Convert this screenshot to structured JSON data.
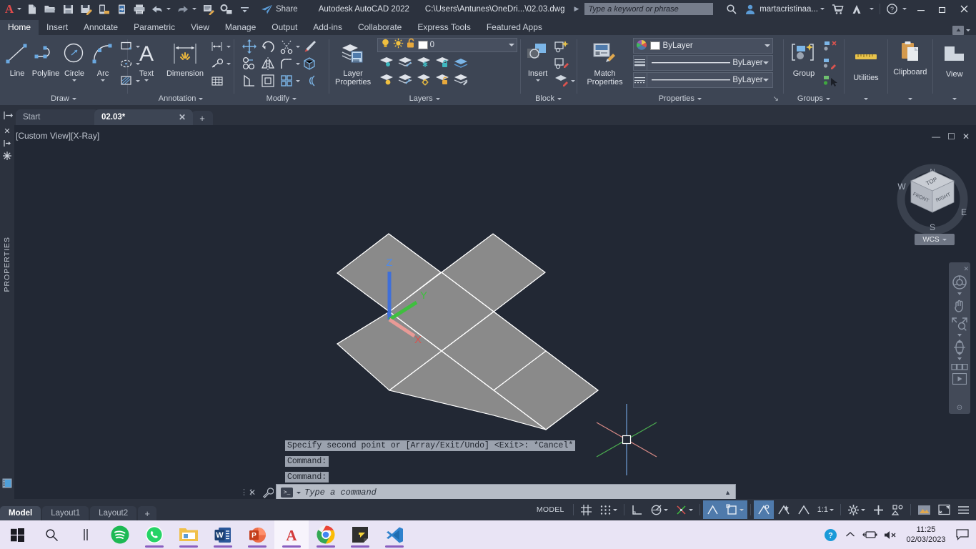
{
  "titlebar": {
    "app_title": "Autodesk AutoCAD 2022",
    "file_path": "C:\\Users\\Antunes\\OneDri...\\02.03.dwg",
    "search_placeholder": "Type a keyword or phrase",
    "share_label": "Share",
    "user_name": "martacristinaa...",
    "quick_access": [
      {
        "name": "new-icon",
        "title": "New"
      },
      {
        "name": "open-icon",
        "title": "Open"
      },
      {
        "name": "save-icon",
        "title": "Save"
      },
      {
        "name": "save-as-icon",
        "title": "Save As"
      },
      {
        "name": "save-to-web-icon",
        "title": "Save to Web & Mobile"
      },
      {
        "name": "open-from-web-icon",
        "title": "Open from Web & Mobile"
      },
      {
        "name": "plot-icon",
        "title": "Plot"
      },
      {
        "name": "undo-icon",
        "title": "Undo"
      },
      {
        "name": "redo-icon",
        "title": "Redo"
      },
      {
        "name": "batch-plot-icon",
        "title": "Batch Plot"
      },
      {
        "name": "attach-icon",
        "title": "Attach"
      }
    ],
    "window_buttons": [
      "minimize",
      "restore",
      "close"
    ]
  },
  "ribbon_tabs": [
    {
      "label": "Home",
      "active": true
    },
    {
      "label": "Insert",
      "active": false
    },
    {
      "label": "Annotate",
      "active": false
    },
    {
      "label": "Parametric",
      "active": false
    },
    {
      "label": "View",
      "active": false
    },
    {
      "label": "Manage",
      "active": false
    },
    {
      "label": "Output",
      "active": false
    },
    {
      "label": "Add-ins",
      "active": false
    },
    {
      "label": "Collaborate",
      "active": false
    },
    {
      "label": "Express Tools",
      "active": false
    },
    {
      "label": "Featured Apps",
      "active": false
    }
  ],
  "ribbon": {
    "draw": {
      "title": "Draw",
      "buttons": [
        {
          "label": "Line",
          "icon": "line-icon"
        },
        {
          "label": "Polyline",
          "icon": "polyline-icon"
        },
        {
          "label": "Circle",
          "icon": "circle-icon"
        },
        {
          "label": "Arc",
          "icon": "arc-icon"
        }
      ],
      "small": [
        "rectangle-icon",
        "ellipse-icon",
        "hatch-icon"
      ]
    },
    "annotation": {
      "title": "Annotation",
      "buttons": [
        {
          "label": "Text",
          "icon": "text-icon"
        },
        {
          "label": "Dimension",
          "icon": "dimension-icon"
        }
      ],
      "small": [
        "linear-dimension-icon",
        "leader-icon",
        "table-icon"
      ]
    },
    "modify": {
      "title": "Modify",
      "small": [
        "move-icon",
        "rotate-icon",
        "trim-icon",
        "erase-icon",
        "copy-icon",
        "mirror-icon",
        "fillet-icon",
        "array-3d-icon",
        "stretch-icon",
        "scale-icon",
        "array-icon",
        "offset-icon"
      ]
    },
    "layers": {
      "title": "Layers",
      "button": {
        "label": "Layer\nProperties",
        "icon": "layer-properties-icon"
      },
      "current_layer": "0",
      "layer_toggles": [
        "lightbulb-icon",
        "sun-icon",
        "unlock-icon"
      ],
      "small": [
        "layer-isolate-icon",
        "layer-unisolate-icon",
        "layer-freeze-icon",
        "layer-lock-icon",
        "layer-make-current-icon",
        "layer-off-icon",
        "layer-match-icon",
        "layer-turn-all-on-icon",
        "layer-unlock-icon",
        "layer-change-to-current-icon"
      ]
    },
    "block": {
      "title": "Block",
      "button": {
        "label": "Insert",
        "icon": "insert-block-icon"
      },
      "small": [
        "create-block-icon",
        "edit-block-icon",
        "edit-attribute-icon"
      ]
    },
    "properties": {
      "title": "Properties",
      "button": {
        "label": "Match\nProperties",
        "icon": "match-properties-icon"
      },
      "color": "ByLayer",
      "linewidth": "ByLayer",
      "linetype": "ByLayer",
      "color_swatch": "#ffffff"
    },
    "groups": {
      "title": "Groups",
      "button": {
        "label": "Group",
        "icon": "group-icon"
      },
      "small": [
        "ungroup-icon",
        "group-edit-icon",
        "group-selection-icon"
      ]
    },
    "utilities": {
      "title": "Utilities",
      "label": "Utilities",
      "icon": "measure-ruler-icon"
    },
    "clipboard": {
      "title": "Clipboard",
      "label": "Clipboard",
      "icon": "clipboard-icon"
    },
    "view": {
      "title": "View",
      "label": "View",
      "icon": "view-icon"
    }
  },
  "file_tabs": [
    {
      "label": "Start",
      "active": false,
      "closable": false
    },
    {
      "label": "02.03*",
      "active": true,
      "closable": true
    }
  ],
  "canvas": {
    "view_label": "[Custom View][X-Ray]",
    "properties_rail_label": "PROPERTIES",
    "viewcube": {
      "top": "TOP",
      "front": "FRONT",
      "right": "RIGHT",
      "n": "N",
      "s": "S",
      "e": "E",
      "w": "W"
    },
    "wcs_label": "WCS",
    "navbar_icons": [
      "steering-wheel-icon",
      "pan-icon",
      "zoom-icon",
      "orbit-icon",
      "showmotion-icon"
    ]
  },
  "command": {
    "history": [
      "Specify second point or [Array/Exit/Undo] <Exit>: *Cancel*",
      "Command:",
      "Command:"
    ],
    "placeholder": "Type a command"
  },
  "layout_tabs": [
    {
      "label": "Model",
      "active": true
    },
    {
      "label": "Layout1",
      "active": false
    },
    {
      "label": "Layout2",
      "active": false
    }
  ],
  "statusbar": {
    "model_label": "MODEL",
    "scale": "1:1",
    "items": [
      {
        "name": "grid-display-toggle",
        "icon": "grid-icon",
        "on": false
      },
      {
        "name": "snap-mode-toggle",
        "icon": "snap-icon",
        "on": false
      },
      {
        "name": "ortho-mode-toggle",
        "icon": "ortho-icon",
        "on": false
      },
      {
        "name": "polar-tracking-toggle",
        "icon": "polar-icon",
        "on": false
      },
      {
        "name": "isometric-drafting-toggle",
        "icon": "isodraft-icon",
        "on": false
      },
      {
        "name": "object-snap-toggle",
        "icon": "osnap-icon",
        "on": true
      },
      {
        "name": "3d-object-snap-toggle",
        "icon": "osnap3d-icon",
        "on": true
      },
      {
        "name": "object-snap-tracking-toggle",
        "icon": "otrack-icon",
        "on": true
      },
      {
        "name": "dynamic-ucs-toggle",
        "icon": "ducs-icon",
        "on": false
      },
      {
        "name": "dynamic-input-toggle",
        "icon": "dyn-icon",
        "on": false
      },
      {
        "name": "lineweight-toggle",
        "icon": "lineweight-icon",
        "on": false
      },
      {
        "name": "transparency-toggle",
        "icon": "transparency-icon",
        "on": false
      },
      {
        "name": "selection-cycling-toggle",
        "icon": "selection-cycling-icon",
        "on": false
      },
      {
        "name": "annotation-monitor-toggle",
        "icon": "annotation-monitor-icon",
        "on": false
      },
      {
        "name": "workspace-switching",
        "icon": "gear-icon",
        "on": false
      },
      {
        "name": "annotation-visibility",
        "icon": "annotation-visibility-icon",
        "on": false
      },
      {
        "name": "isolate-objects",
        "icon": "isolate-objects-icon",
        "on": false
      },
      {
        "name": "hardware-acceleration",
        "icon": "graphics-icon",
        "on": false
      },
      {
        "name": "clean-screen",
        "icon": "clean-screen-icon",
        "on": false
      },
      {
        "name": "customization",
        "icon": "hamburger-icon",
        "on": false
      }
    ]
  },
  "taskbar": {
    "apps": [
      {
        "name": "start-button",
        "icon": "windows-icon",
        "running": false,
        "active": false
      },
      {
        "name": "search-taskbar",
        "icon": "search-icon",
        "running": false,
        "active": false
      },
      {
        "name": "task-view",
        "icon": "task-view-icon",
        "running": false,
        "active": false
      },
      {
        "name": "spotify",
        "icon": "spotify-icon",
        "running": true,
        "active": false
      },
      {
        "name": "whatsapp",
        "icon": "whatsapp-icon",
        "running": true,
        "active": false
      },
      {
        "name": "file-explorer",
        "icon": "folder-icon",
        "running": true,
        "active": false
      },
      {
        "name": "word",
        "icon": "word-icon",
        "running": true,
        "active": false
      },
      {
        "name": "powerpoint",
        "icon": "powerpoint-icon",
        "running": true,
        "active": false
      },
      {
        "name": "autocad",
        "icon": "autocad-icon",
        "running": true,
        "active": true
      },
      {
        "name": "chrome",
        "icon": "chrome-icon",
        "running": true,
        "active": false
      },
      {
        "name": "sticky-notes",
        "icon": "sticky-notes-icon",
        "running": true,
        "active": false
      },
      {
        "name": "vscode",
        "icon": "vscode-icon",
        "running": true,
        "active": false
      }
    ],
    "tray": [
      "help-icon",
      "chevron-up-icon",
      "battery-icon",
      "volume-muted-icon"
    ],
    "time": "11:25",
    "date": "02/03/2023"
  },
  "colors": {
    "ribbon_bg": "#3d4554",
    "titlebar_bg": "#2c323e",
    "canvas_bg": "#222834",
    "accent_blue": "#4f7aab",
    "taskbar_bg": "#e9e4f5",
    "shape_fill": "#8a8a8a",
    "axis_x": "#d9534f",
    "axis_y": "#3fbf3f",
    "axis_z": "#3f6fd9"
  }
}
